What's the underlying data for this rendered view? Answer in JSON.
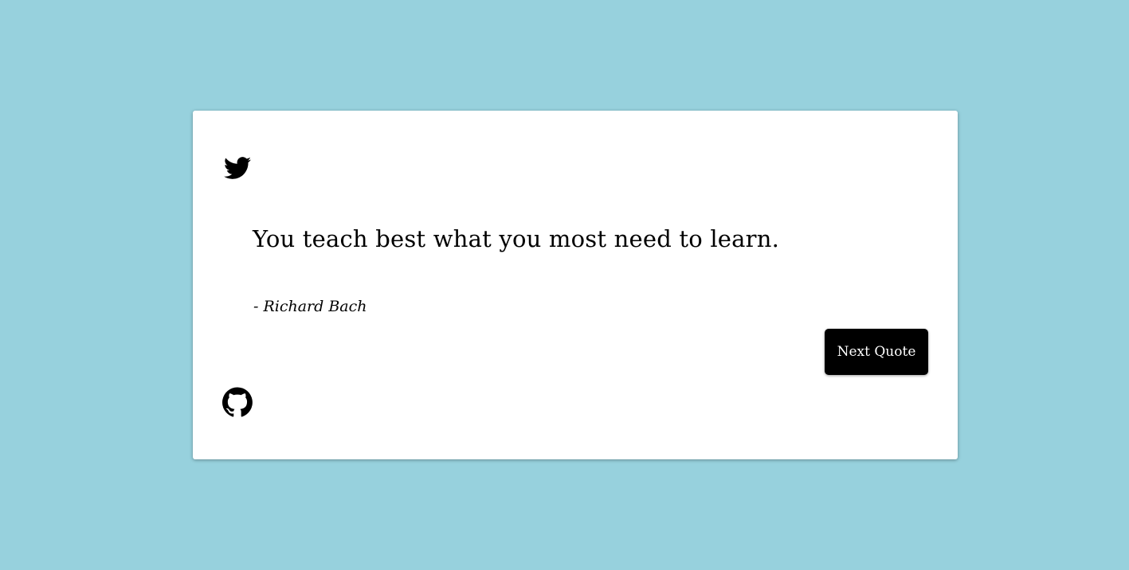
{
  "quote": {
    "text": "You teach best what you most need to learn.",
    "author": "- Richard Bach"
  },
  "actions": {
    "next_label": "Next Quote"
  },
  "icons": {
    "share": "twitter-icon",
    "source": "github-icon"
  },
  "colors": {
    "background": "#97d1dd",
    "card": "#ffffff",
    "button": "#000000",
    "button_text": "#ffffff"
  }
}
